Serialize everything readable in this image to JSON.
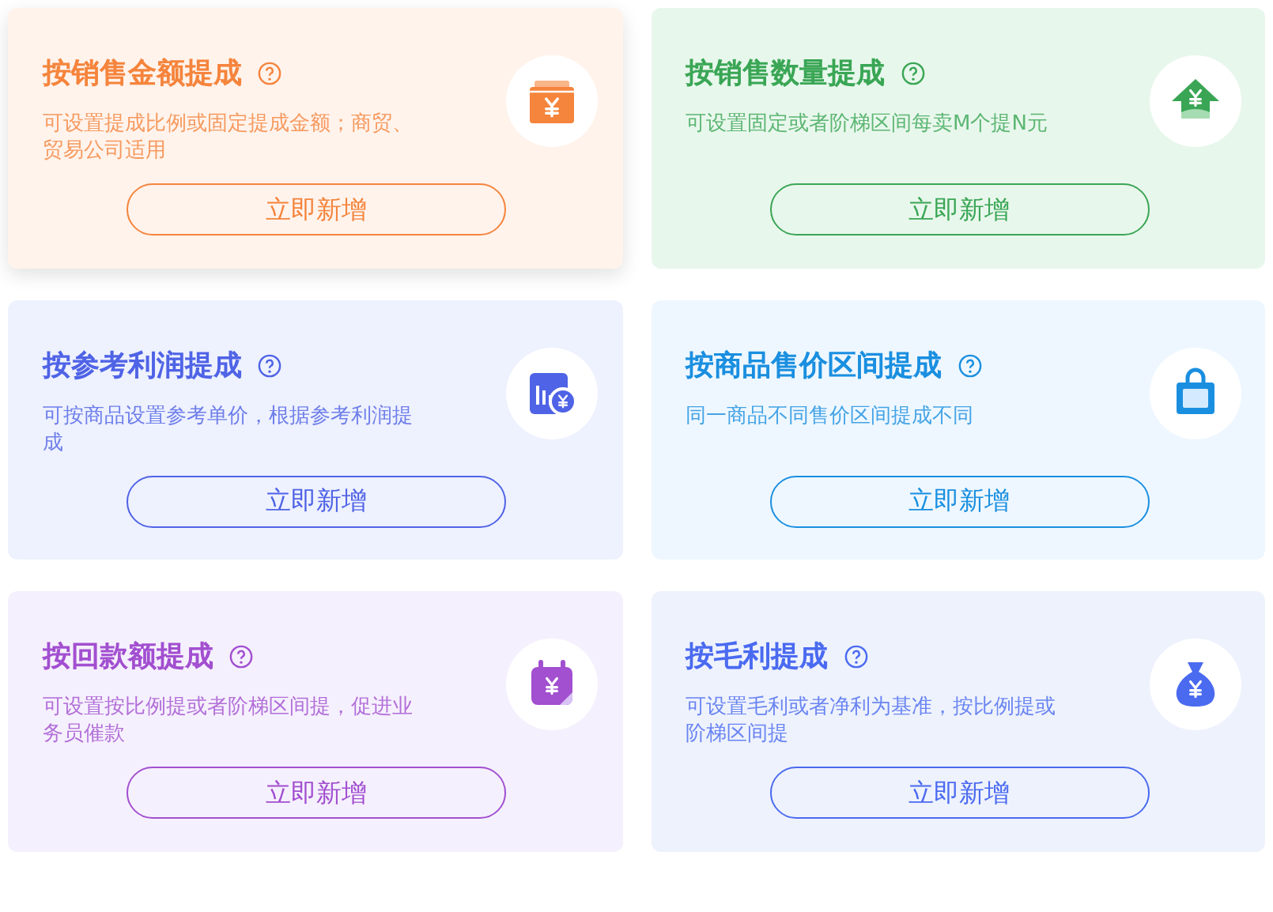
{
  "cards": [
    {
      "title": "按销售金额提成",
      "description": "可设置提成比例或固定提成金额；商贸、贸易公司适用",
      "button": "立即新增",
      "color": "#f5843c",
      "raised": true
    },
    {
      "title": "按销售数量提成",
      "description": "可设置固定或者阶梯区间每卖M个提N元",
      "button": "立即新增",
      "color": "#3aa655",
      "raised": false
    },
    {
      "title": "按参考利润提成",
      "description": "可按商品设置参考单价，根据参考利润提成",
      "button": "立即新增",
      "color": "#4f63e6",
      "raised": false
    },
    {
      "title": "按商品售价区间提成",
      "description": "同一商品不同售价区间提成不同",
      "button": "立即新增",
      "color": "#1a8fe0",
      "raised": false
    },
    {
      "title": "按回款额提成",
      "description": "可设置按比例提或者阶梯区间提，促进业务员催款",
      "button": "立即新增",
      "color": "#a24fd0",
      "raised": false
    },
    {
      "title": "按毛利提成",
      "description": "可设置毛利或者净利为基准，按比例提或阶梯区间提",
      "button": "立即新增",
      "color": "#4a6af0",
      "raised": false
    }
  ]
}
